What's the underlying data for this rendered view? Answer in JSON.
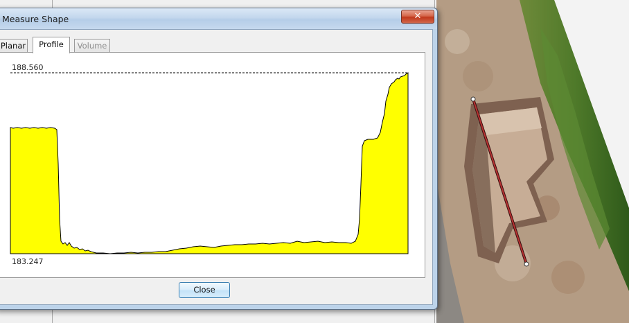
{
  "window": {
    "title": "Measure Shape",
    "close_glyph": "✕"
  },
  "tabs": [
    {
      "label": "Planar",
      "state": "normal"
    },
    {
      "label": "Profile",
      "state": "selected"
    },
    {
      "label": "Volume",
      "state": "disabled"
    }
  ],
  "profile": {
    "max_label": "188.560",
    "min_label": "183.247",
    "fill_color": "#ffff00"
  },
  "buttons": {
    "close_label": "Close"
  }
}
